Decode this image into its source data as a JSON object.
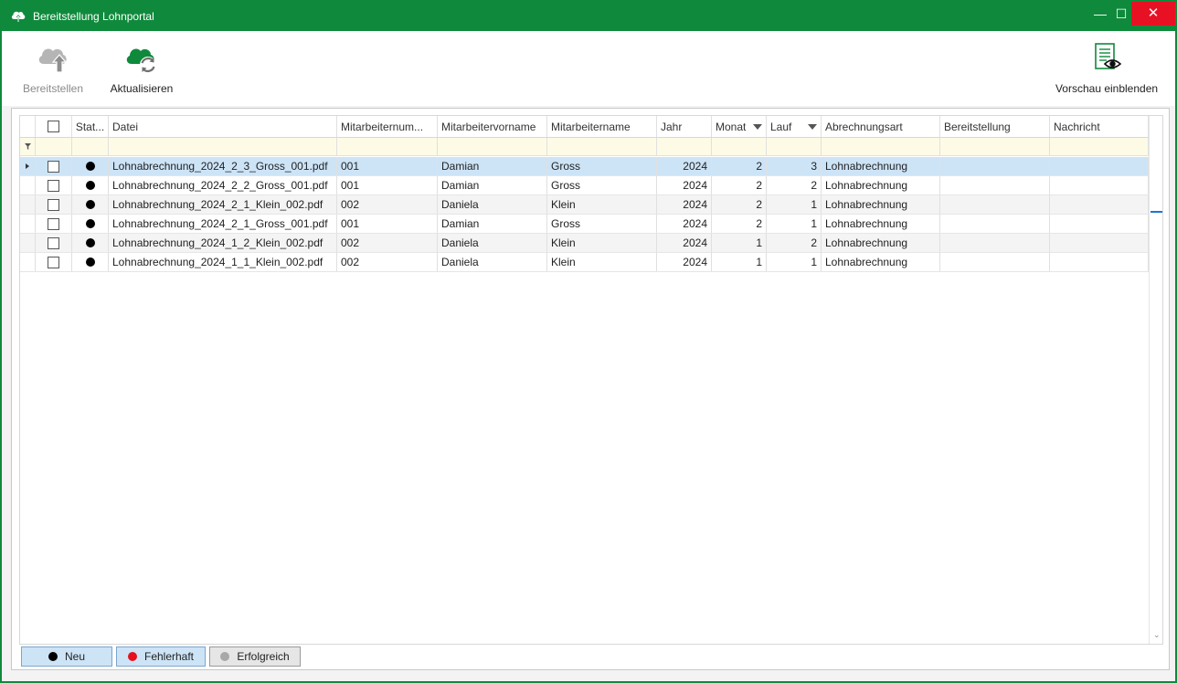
{
  "window": {
    "title": "Bereitstellung Lohnportal",
    "controls": {
      "minimize": "—",
      "maximize": "☐",
      "close": "✕"
    }
  },
  "toolbar": {
    "bereitstellen": {
      "label": "Bereitstellen",
      "icon": "cloud-upload-icon",
      "enabled": false
    },
    "aktualisieren": {
      "label": "Aktualisieren",
      "icon": "cloud-refresh-icon",
      "enabled": true
    },
    "vorschau": {
      "label": "Vorschau einblenden",
      "icon": "document-preview-icon",
      "enabled": true
    }
  },
  "grid": {
    "columns": [
      {
        "key": "status",
        "label": "Stat..."
      },
      {
        "key": "datei",
        "label": "Datei"
      },
      {
        "key": "mitarbeiternummer",
        "label": "Mitarbeiternum..."
      },
      {
        "key": "vorname",
        "label": "Mitarbeitervorname"
      },
      {
        "key": "name",
        "label": "Mitarbeitername"
      },
      {
        "key": "jahr",
        "label": "Jahr"
      },
      {
        "key": "monat",
        "label": "Monat",
        "sorted": "desc"
      },
      {
        "key": "lauf",
        "label": "Lauf",
        "sorted": "desc"
      },
      {
        "key": "abrechnungsart",
        "label": "Abrechnungsart"
      },
      {
        "key": "bereitstellung",
        "label": "Bereitstellung"
      },
      {
        "key": "nachricht",
        "label": "Nachricht"
      }
    ],
    "rows": [
      {
        "datei": "Lohnabrechnung_2024_2_3_Gross_001.pdf",
        "nummer": "001",
        "vorname": "Damian",
        "name": "Gross",
        "jahr": "2024",
        "monat": "2",
        "lauf": "3",
        "art": "Lohnabrechnung",
        "bereitstellung": "",
        "nachricht": "",
        "status": "Neu"
      },
      {
        "datei": "Lohnabrechnung_2024_2_2_Gross_001.pdf",
        "nummer": "001",
        "vorname": "Damian",
        "name": "Gross",
        "jahr": "2024",
        "monat": "2",
        "lauf": "2",
        "art": "Lohnabrechnung",
        "bereitstellung": "",
        "nachricht": "",
        "status": "Neu"
      },
      {
        "datei": "Lohnabrechnung_2024_2_1_Klein_002.pdf",
        "nummer": "002",
        "vorname": "Daniela",
        "name": "Klein",
        "jahr": "2024",
        "monat": "2",
        "lauf": "1",
        "art": "Lohnabrechnung",
        "bereitstellung": "",
        "nachricht": "",
        "status": "Neu"
      },
      {
        "datei": "Lohnabrechnung_2024_2_1_Gross_001.pdf",
        "nummer": "001",
        "vorname": "Damian",
        "name": "Gross",
        "jahr": "2024",
        "monat": "2",
        "lauf": "1",
        "art": "Lohnabrechnung",
        "bereitstellung": "",
        "nachricht": "",
        "status": "Neu"
      },
      {
        "datei": "Lohnabrechnung_2024_1_2_Klein_002.pdf",
        "nummer": "002",
        "vorname": "Daniela",
        "name": "Klein",
        "jahr": "2024",
        "monat": "1",
        "lauf": "2",
        "art": "Lohnabrechnung",
        "bereitstellung": "",
        "nachricht": "",
        "status": "Neu"
      },
      {
        "datei": "Lohnabrechnung_2024_1_1_Klein_002.pdf",
        "nummer": "002",
        "vorname": "Daniela",
        "name": "Klein",
        "jahr": "2024",
        "monat": "1",
        "lauf": "1",
        "art": "Lohnabrechnung",
        "bereitstellung": "",
        "nachricht": "",
        "status": "Neu"
      }
    ],
    "selected_row": 0
  },
  "legend": {
    "neu": {
      "label": "Neu",
      "color": "#000000",
      "active": true
    },
    "fehlerhaft": {
      "label": "Fehlerhaft",
      "color": "#e8101c",
      "active": true
    },
    "erfolgreich": {
      "label": "Erfolgreich",
      "color": "#a8a8a8",
      "active": false
    }
  },
  "colors": {
    "accent": "#0f8a3c",
    "selection": "#cde4f7",
    "filter_row": "#fdfbe6",
    "status_neu": "#000000"
  }
}
